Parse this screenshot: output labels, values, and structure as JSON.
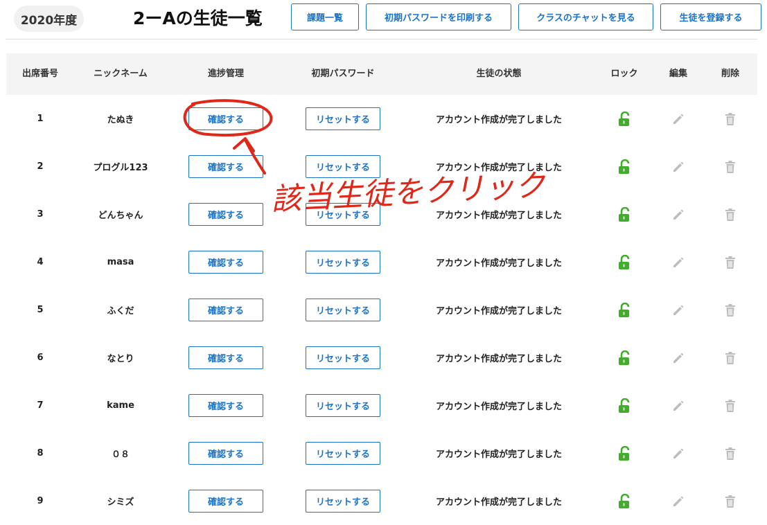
{
  "header": {
    "year": "2020年度",
    "title": "2ーAの生徒一覧",
    "buttons": [
      "課題一覧",
      "初期パスワードを印刷する",
      "クラスのチャットを見る",
      "生徒を登録する"
    ]
  },
  "table": {
    "columns": [
      "出席番号",
      "ニックネーム",
      "進捗管理",
      "初期パスワード",
      "生徒の状態",
      "ロック",
      "編集",
      "削除"
    ],
    "progress_button": "確認する",
    "reset_button": "リセットする",
    "rows": [
      {
        "no": "1",
        "nickname": "たぬき",
        "status": "アカウント作成が完了しました"
      },
      {
        "no": "2",
        "nickname": "プログル123",
        "status": "アカウント作成が完了しました"
      },
      {
        "no": "3",
        "nickname": "どんちゃん",
        "status": "アカウント作成が完了しました"
      },
      {
        "no": "4",
        "nickname": "masa",
        "status": "アカウント作成が完了しました"
      },
      {
        "no": "5",
        "nickname": "ふくだ",
        "status": "アカウント作成が完了しました"
      },
      {
        "no": "6",
        "nickname": "なとり",
        "status": "アカウント作成が完了しました"
      },
      {
        "no": "7",
        "nickname": "kame",
        "status": "アカウント作成が完了しました"
      },
      {
        "no": "8",
        "nickname": "０８",
        "status": "アカウント作成が完了しました"
      },
      {
        "no": "9",
        "nickname": "シミズ",
        "status": "アカウント作成が完了しました"
      }
    ],
    "icons": {
      "lock": "unlocked-lock-icon",
      "edit": "pencil-icon",
      "delete": "trash-icon"
    }
  },
  "annotation": {
    "text": "該当生徒をクリック",
    "color": "#e0281a"
  },
  "colors": {
    "accent": "#1a73c8",
    "lock_green": "#3fae29",
    "icon_gray": "#bdbdbd"
  }
}
